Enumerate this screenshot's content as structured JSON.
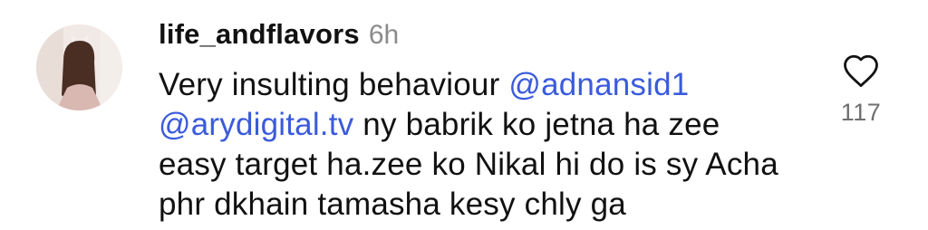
{
  "comment": {
    "username": "life_andflavors",
    "time": "6h",
    "text_parts": {
      "p1": "Very insulting behaviour ",
      "mention1": "@adnansid1",
      "mention2": "@arydigital.tv",
      "p2": " ny babrik ko jetna ha zee easy target ha.zee ko Nikal hi do is sy Acha phr dkhain tamasha kesy chly ga"
    },
    "like_count": "117",
    "mention_color": "#3b5bdb",
    "like_icon": "heart-outline-icon"
  }
}
